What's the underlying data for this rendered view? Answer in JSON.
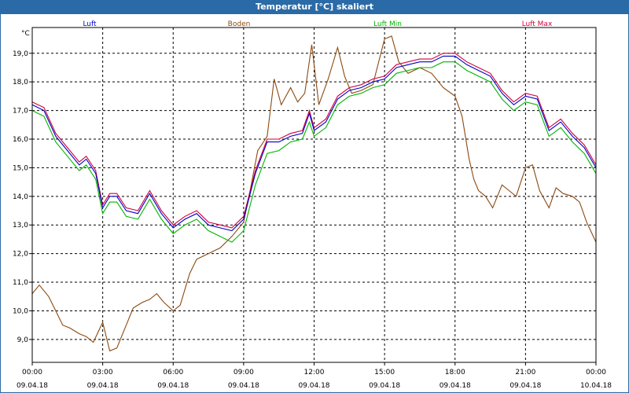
{
  "window": {
    "title": "Temperatur [°C] skaliert"
  },
  "chart_data": {
    "type": "line",
    "title": "Temperatur [°C] skaliert",
    "ylabel": "°C",
    "xlabel": "",
    "ylim": [
      8.2,
      19.9
    ],
    "y_ticks": [
      "9,0",
      "10,0",
      "11,0",
      "12,0",
      "13,0",
      "14,0",
      "15,0",
      "16,0",
      "17,0",
      "18,0",
      "19,0"
    ],
    "y_tick_values": [
      9,
      10,
      11,
      12,
      13,
      14,
      15,
      16,
      17,
      18,
      19
    ],
    "x_tick_times": [
      "00:00",
      "03:00",
      "06:00",
      "09:00",
      "12:00",
      "15:00",
      "18:00",
      "21:00",
      "00:00"
    ],
    "x_tick_dates": [
      "09.04.18",
      "09.04.18",
      "09.04.18",
      "09.04.18",
      "09.04.18",
      "09.04.18",
      "09.04.18",
      "09.04.18",
      "10.04.18"
    ],
    "x_hours": [
      0,
      3,
      6,
      9,
      12,
      15,
      18,
      21,
      24
    ],
    "grid": true,
    "legend_position": "top",
    "series": [
      {
        "name": "Luft",
        "color": "#0000c8",
        "x": [
          0,
          0.5,
          1,
          1.5,
          2,
          2.3,
          2.7,
          3,
          3.3,
          3.6,
          4,
          4.5,
          5,
          5.5,
          6,
          6.5,
          7,
          7.5,
          8,
          8.5,
          9,
          9.5,
          10,
          10.5,
          11,
          11.5,
          11.8,
          12,
          12.5,
          13,
          13.5,
          14,
          14.5,
          15,
          15.5,
          16,
          16.5,
          17,
          17.5,
          18,
          18.5,
          19,
          19.5,
          20,
          20.5,
          21,
          21.5,
          22,
          22.5,
          23,
          23.5,
          24
        ],
        "values": [
          17.2,
          17.0,
          16.1,
          15.6,
          15.1,
          15.3,
          14.8,
          13.6,
          14.0,
          14.0,
          13.5,
          13.4,
          14.1,
          13.4,
          12.9,
          13.2,
          13.4,
          13.0,
          12.9,
          12.8,
          13.2,
          14.8,
          15.9,
          15.9,
          16.1,
          16.2,
          16.9,
          16.3,
          16.6,
          17.4,
          17.7,
          17.8,
          18.0,
          18.1,
          18.5,
          18.6,
          18.7,
          18.7,
          18.9,
          18.9,
          18.6,
          18.4,
          18.2,
          17.6,
          17.2,
          17.5,
          17.4,
          16.3,
          16.6,
          16.1,
          15.7,
          15.0
        ]
      },
      {
        "name": "Boden",
        "color": "#8b4a10",
        "x": [
          0,
          0.3,
          0.7,
          1,
          1.3,
          1.6,
          2,
          2.3,
          2.6,
          3,
          3.3,
          3.6,
          4,
          4.3,
          4.7,
          5,
          5.3,
          5.6,
          6,
          6.3,
          6.7,
          7,
          7.5,
          8,
          8.5,
          9,
          9.3,
          9.6,
          10,
          10.3,
          10.6,
          11,
          11.3,
          11.6,
          11.9,
          12.2,
          12.6,
          13,
          13.3,
          13.6,
          14,
          14.5,
          15,
          15.3,
          15.6,
          16,
          16.5,
          17,
          17.5,
          18,
          18.3,
          18.6,
          18.8,
          19,
          19.3,
          19.6,
          20,
          20.3,
          20.6,
          21,
          21.3,
          21.6,
          22,
          22.3,
          22.6,
          23,
          23.3,
          23.6,
          24
        ],
        "values": [
          10.6,
          10.9,
          10.5,
          10.0,
          9.5,
          9.4,
          9.2,
          9.1,
          8.9,
          9.6,
          8.6,
          8.7,
          9.5,
          10.1,
          10.3,
          10.4,
          10.6,
          10.3,
          10.0,
          10.2,
          11.3,
          11.8,
          12.0,
          12.2,
          12.6,
          13.1,
          14.3,
          15.6,
          16.1,
          18.1,
          17.2,
          17.8,
          17.3,
          17.6,
          19.3,
          17.2,
          18.1,
          19.2,
          18.2,
          17.6,
          17.7,
          17.9,
          19.5,
          19.6,
          18.7,
          18.3,
          18.5,
          18.3,
          17.8,
          17.5,
          16.8,
          15.3,
          14.6,
          14.2,
          14.0,
          13.6,
          14.4,
          14.2,
          14.0,
          15.0,
          15.1,
          14.2,
          13.6,
          14.3,
          14.1,
          14.0,
          13.8,
          13.1,
          12.4
        ]
      },
      {
        "name": "Luft Min",
        "color": "#00b400",
        "x": [
          0,
          0.5,
          1,
          1.5,
          2,
          2.3,
          2.7,
          3,
          3.3,
          3.6,
          4,
          4.5,
          5,
          5.5,
          6,
          6.5,
          7,
          7.5,
          8,
          8.5,
          9,
          9.5,
          10,
          10.5,
          11,
          11.5,
          11.8,
          12,
          12.5,
          13,
          13.5,
          14,
          14.5,
          15,
          15.5,
          16,
          16.5,
          17,
          17.5,
          18,
          18.5,
          19,
          19.5,
          20,
          20.5,
          21,
          21.5,
          22,
          22.5,
          23,
          23.5,
          24
        ],
        "values": [
          17.0,
          16.8,
          15.9,
          15.4,
          14.9,
          15.1,
          14.6,
          13.4,
          13.8,
          13.8,
          13.3,
          13.2,
          13.9,
          13.2,
          12.7,
          13.0,
          13.2,
          12.8,
          12.6,
          12.4,
          12.8,
          14.4,
          15.5,
          15.6,
          15.9,
          16.0,
          16.6,
          16.1,
          16.4,
          17.2,
          17.5,
          17.6,
          17.8,
          17.9,
          18.3,
          18.4,
          18.5,
          18.5,
          18.7,
          18.7,
          18.4,
          18.2,
          18.0,
          17.4,
          17.0,
          17.3,
          17.2,
          16.1,
          16.4,
          15.9,
          15.5,
          14.8
        ]
      },
      {
        "name": "Luft Max",
        "color": "#d2003c",
        "x": [
          0,
          0.5,
          1,
          1.5,
          2,
          2.3,
          2.7,
          3,
          3.3,
          3.6,
          4,
          4.5,
          5,
          5.5,
          6,
          6.5,
          7,
          7.5,
          8,
          8.5,
          9,
          9.5,
          10,
          10.5,
          11,
          11.5,
          11.8,
          12,
          12.5,
          13,
          13.5,
          14,
          14.5,
          15,
          15.5,
          16,
          16.5,
          17,
          17.5,
          18,
          18.5,
          19,
          19.5,
          20,
          20.5,
          21,
          21.5,
          22,
          22.5,
          23,
          23.5,
          24
        ],
        "values": [
          17.3,
          17.1,
          16.2,
          15.7,
          15.2,
          15.4,
          14.9,
          13.7,
          14.1,
          14.1,
          13.6,
          13.5,
          14.2,
          13.5,
          13.0,
          13.3,
          13.5,
          13.1,
          13.0,
          12.9,
          13.3,
          14.9,
          16.0,
          16.0,
          16.2,
          16.3,
          17.0,
          16.4,
          16.7,
          17.5,
          17.8,
          17.9,
          18.1,
          18.2,
          18.6,
          18.7,
          18.8,
          18.8,
          19.0,
          19.0,
          18.7,
          18.5,
          18.3,
          17.7,
          17.3,
          17.6,
          17.5,
          16.4,
          16.7,
          16.2,
          15.8,
          15.1
        ]
      }
    ]
  }
}
